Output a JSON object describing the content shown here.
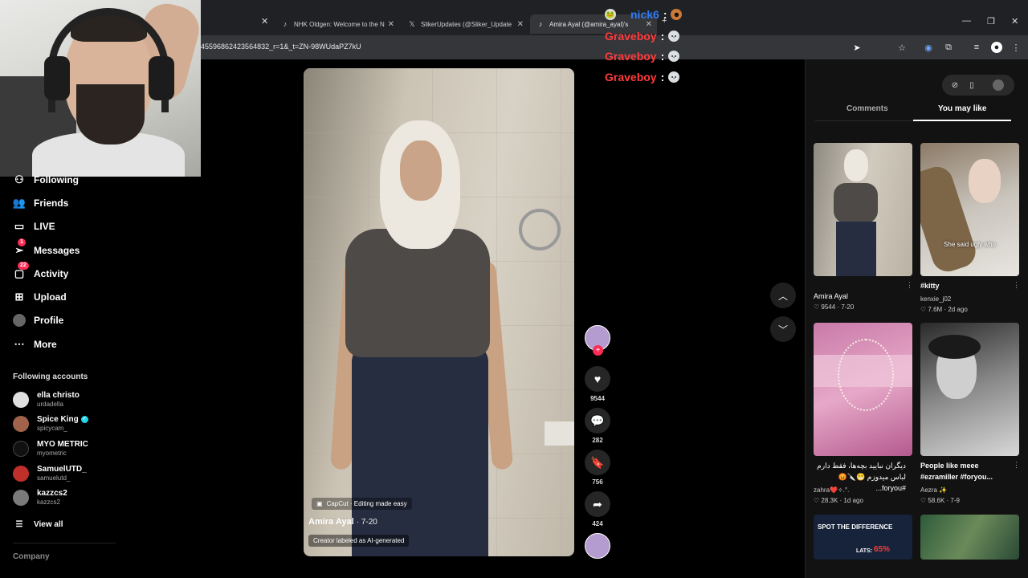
{
  "browser": {
    "tabs": [
      {
        "title": "NHK Oldgen: Welcome to the N",
        "icon": "tiktok-icon"
      },
      {
        "title": "SlikerUpdates (@Sliker_Update",
        "icon": "x-icon"
      },
      {
        "title": "Amira Ayal (@amira_ayal)'s",
        "icon": "tiktok-icon"
      }
    ],
    "url": "45596862423564832_r=1&_t=ZN-98WUdaPZ7kU"
  },
  "chat": [
    {
      "user": "nick6",
      "emote": "🐸"
    },
    {
      "user": "Graveboy",
      "emote": "💀"
    },
    {
      "user": "Graveboy",
      "emote": "💀"
    },
    {
      "user": "Graveboy",
      "emote": "💀"
    }
  ],
  "sidebar": {
    "items": [
      {
        "label": "Following",
        "icon": "following-icon"
      },
      {
        "label": "Friends",
        "icon": "friends-icon"
      },
      {
        "label": "LIVE",
        "icon": "live-icon"
      },
      {
        "label": "Messages",
        "icon": "messages-icon",
        "badge": "1"
      },
      {
        "label": "Activity",
        "icon": "activity-icon",
        "badge": "22"
      },
      {
        "label": "Upload",
        "icon": "upload-icon"
      },
      {
        "label": "Profile",
        "icon": "profile-icon"
      },
      {
        "label": "More",
        "icon": "more-icon"
      }
    ],
    "following_title": "Following accounts",
    "accounts": [
      {
        "name": "ella christo",
        "handle": "urdadella",
        "color": "#e0e0e0"
      },
      {
        "name": "Spice King",
        "handle": "spicycam_",
        "color": "#a0624a",
        "verified": true
      },
      {
        "name": "MYO METRIC",
        "handle": "myometric",
        "color": "#111111"
      },
      {
        "name": "SamuelUTD_",
        "handle": "samuelutd_",
        "color": "#c0302a"
      },
      {
        "name": "kazzcs2",
        "handle": "kazzcs2",
        "color": "#7a7a7a"
      }
    ],
    "view_all": "View all",
    "company": "Company"
  },
  "video": {
    "capcut": "CapCut · Editing made easy",
    "author": "Amira Ayal",
    "date": "· 7-20",
    "ai_label": "Creator labeled as AI-generated"
  },
  "actions": {
    "likes": "9544",
    "comments": "282",
    "saves": "756",
    "shares": "424"
  },
  "panel": {
    "tab_comments": "Comments",
    "tab_you_may_like": "You may like",
    "cards": [
      {
        "title": "",
        "user": "Amira Ayal",
        "likes": "9544",
        "age": "7-20",
        "caption": ""
      },
      {
        "title": "#kitty",
        "user": "kenxie_j02",
        "likes": "7.6M",
        "age": "2d ago",
        "caption": "She said ugly who"
      },
      {
        "title": "دیگران نبایید بچه‌ها، فقط دارم لباس میدوزم 😁🔪😡 #foryou...",
        "user": "zahra❤️✧.°.",
        "likes": "28.3K",
        "age": "1d ago",
        "caption": ""
      },
      {
        "title": "People like meee #ezramiller #foryou...",
        "user": "Aezra ✨",
        "likes": "58.6K",
        "age": "7-9",
        "caption": ""
      }
    ],
    "spot_title": "SPOT THE DIFFERENCE",
    "spot_percent": "65%",
    "spot_small": "LATS:"
  },
  "colors": {
    "accent": "#fe2c55",
    "chat_red": "#ff3b3b",
    "chat_blue": "#2e7cf6"
  }
}
